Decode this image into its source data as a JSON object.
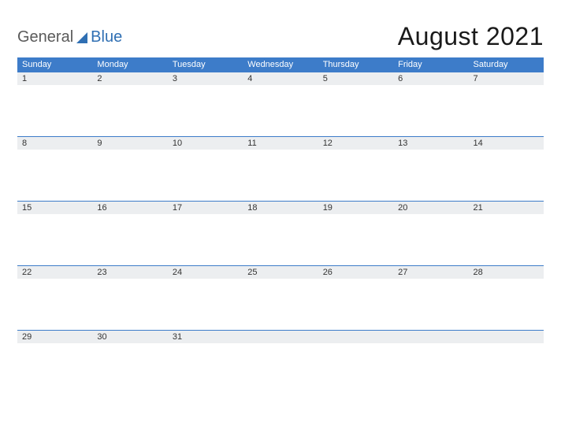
{
  "brand": {
    "part1": "General",
    "part2": "Blue"
  },
  "title": "August 2021",
  "days": [
    "Sunday",
    "Monday",
    "Tuesday",
    "Wednesday",
    "Thursday",
    "Friday",
    "Saturday"
  ],
  "weeks": [
    [
      "1",
      "2",
      "3",
      "4",
      "5",
      "6",
      "7"
    ],
    [
      "8",
      "9",
      "10",
      "11",
      "12",
      "13",
      "14"
    ],
    [
      "15",
      "16",
      "17",
      "18",
      "19",
      "20",
      "21"
    ],
    [
      "22",
      "23",
      "24",
      "25",
      "26",
      "27",
      "28"
    ],
    [
      "29",
      "30",
      "31",
      "",
      "",
      "",
      ""
    ]
  ]
}
